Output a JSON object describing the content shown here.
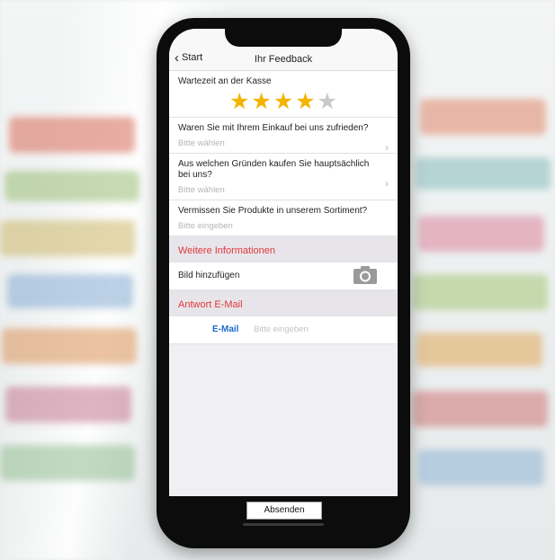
{
  "navbar": {
    "back_label": "Start",
    "title": "Ihr Feedback"
  },
  "rating": {
    "label": "Wartezeit an der Kasse",
    "value": 4,
    "max": 5
  },
  "questions": [
    {
      "label": "Waren Sie mit Ihrem Einkauf bei uns zufrieden?",
      "placeholder": "Bitte wählen"
    },
    {
      "label": "Aus welchen Gründen kaufen Sie hauptsächlich bei uns?",
      "placeholder": "Bitte wählen"
    }
  ],
  "missing_products": {
    "label": "Vermissen Sie Produkte in unserem Sortiment?",
    "placeholder": "Bitte eingeben"
  },
  "more_info": {
    "section_title": "Weitere Informationen",
    "add_image_label": "Bild hinzufügen"
  },
  "reply_email": {
    "section_title": "Antwort E-Mail",
    "key": "E-Mail",
    "placeholder": "Bitte eingeben"
  },
  "submit_label": "Absenden",
  "colors": {
    "accent_red": "#e0383a",
    "link_blue": "#1f6cc8",
    "star": "#f4b400"
  }
}
